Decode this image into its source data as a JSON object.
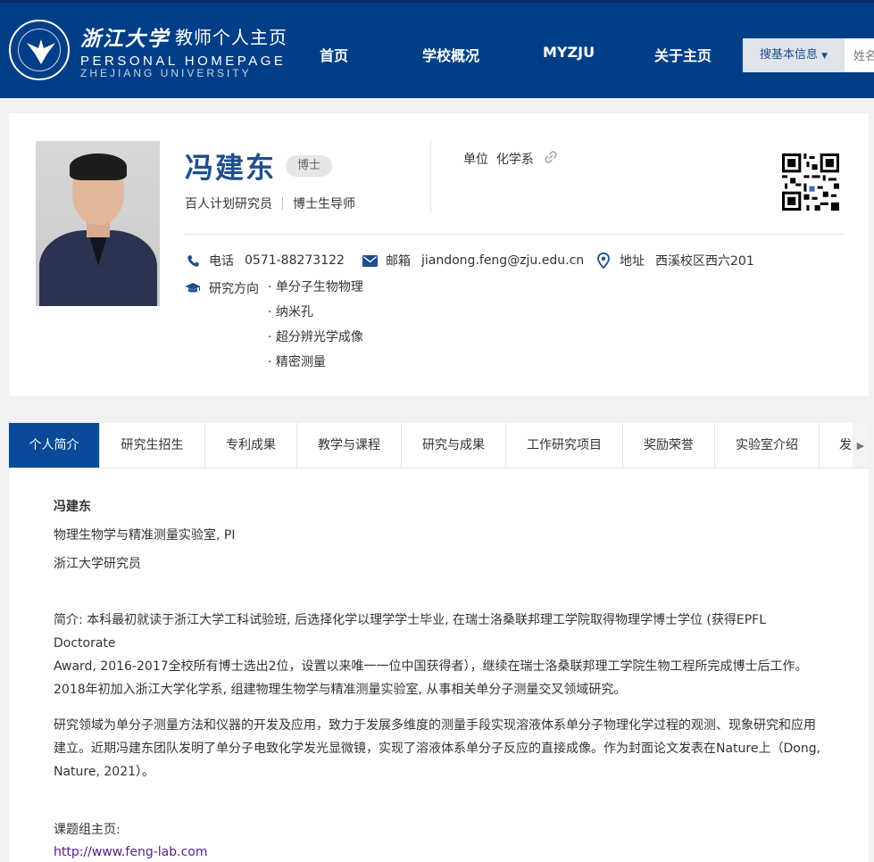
{
  "header": {
    "logo_cn": "浙江大学",
    "logo_title": "教师个人主页",
    "logo_en_line1": "PERSONAL HOMEPAGE",
    "logo_en_line2": "ZHEJIANG UNIVERSITY",
    "nav": [
      "首页",
      "学校概况",
      "MYZJU",
      "关于主页"
    ],
    "search_scope": "搜基本信息",
    "search_placeholder": "姓名"
  },
  "profile": {
    "name": "冯建东",
    "degree": "博士",
    "title1": "百人计划研究员",
    "title2": "博士生导师",
    "unit_label": "单位",
    "unit_value": "化学系",
    "phone_label": "电话",
    "phone": "0571-88273122",
    "email_label": "邮箱",
    "email": "jiandong.feng@zju.edu.cn",
    "address_label": "地址",
    "address": "西溪校区西六201",
    "research_label": "研究方向",
    "research": [
      "单分子生物物理",
      "纳米孔",
      "超分辨光学成像",
      "精密测量"
    ]
  },
  "tabs": [
    "个人简介",
    "研究生招生",
    "专利成果",
    "教学与课程",
    "研究与成果",
    "工作研究项目",
    "奖励荣誉",
    "实验室介绍",
    "发"
  ],
  "content": {
    "name": "冯建东",
    "lab": "物理生物学与精准测量实验室, PI",
    "position": "浙江大学研究员",
    "intro_line1": "简介: 本科最初就读于浙江大学工科试验班, 后选择化学以理学学士毕业, 在瑞士洛桑联邦理工学院取得物理学博士学位 (获得EPFL Doctorate",
    "intro_line2": "Award, 2016-2017全校所有博士选出2位，设置以来唯一一位中国获得者），继续在瑞士洛桑联邦理工学院生物工程所完成博士后工作。",
    "intro_line3": "2018年初加入浙江大学化学系, 组建物理生物学与精准测量实验室, 从事相关单分子测量交叉领域研究。",
    "research_line1": "研究领域为单分子测量方法和仪器的开发及应用，致力于发展多维度的测量手段实现溶液体系单分子物理化学过程的观测、现象研究和应用",
    "research_line2": "建立。近期冯建东团队发明了单分子电致化学发光显微镜，实现了溶液体系单分子反应的直接成像。作为封面论文发表在Nature上（Dong,",
    "research_line3": "Nature, 2021）。",
    "group_label": "课题组主页:",
    "group_url": "http://www.feng-lab.com"
  },
  "colors": {
    "header_bg": "#003f88",
    "name_blue": "#1f4e8c",
    "active_tab": "#0b4a98",
    "link": "#5b1a8f"
  }
}
